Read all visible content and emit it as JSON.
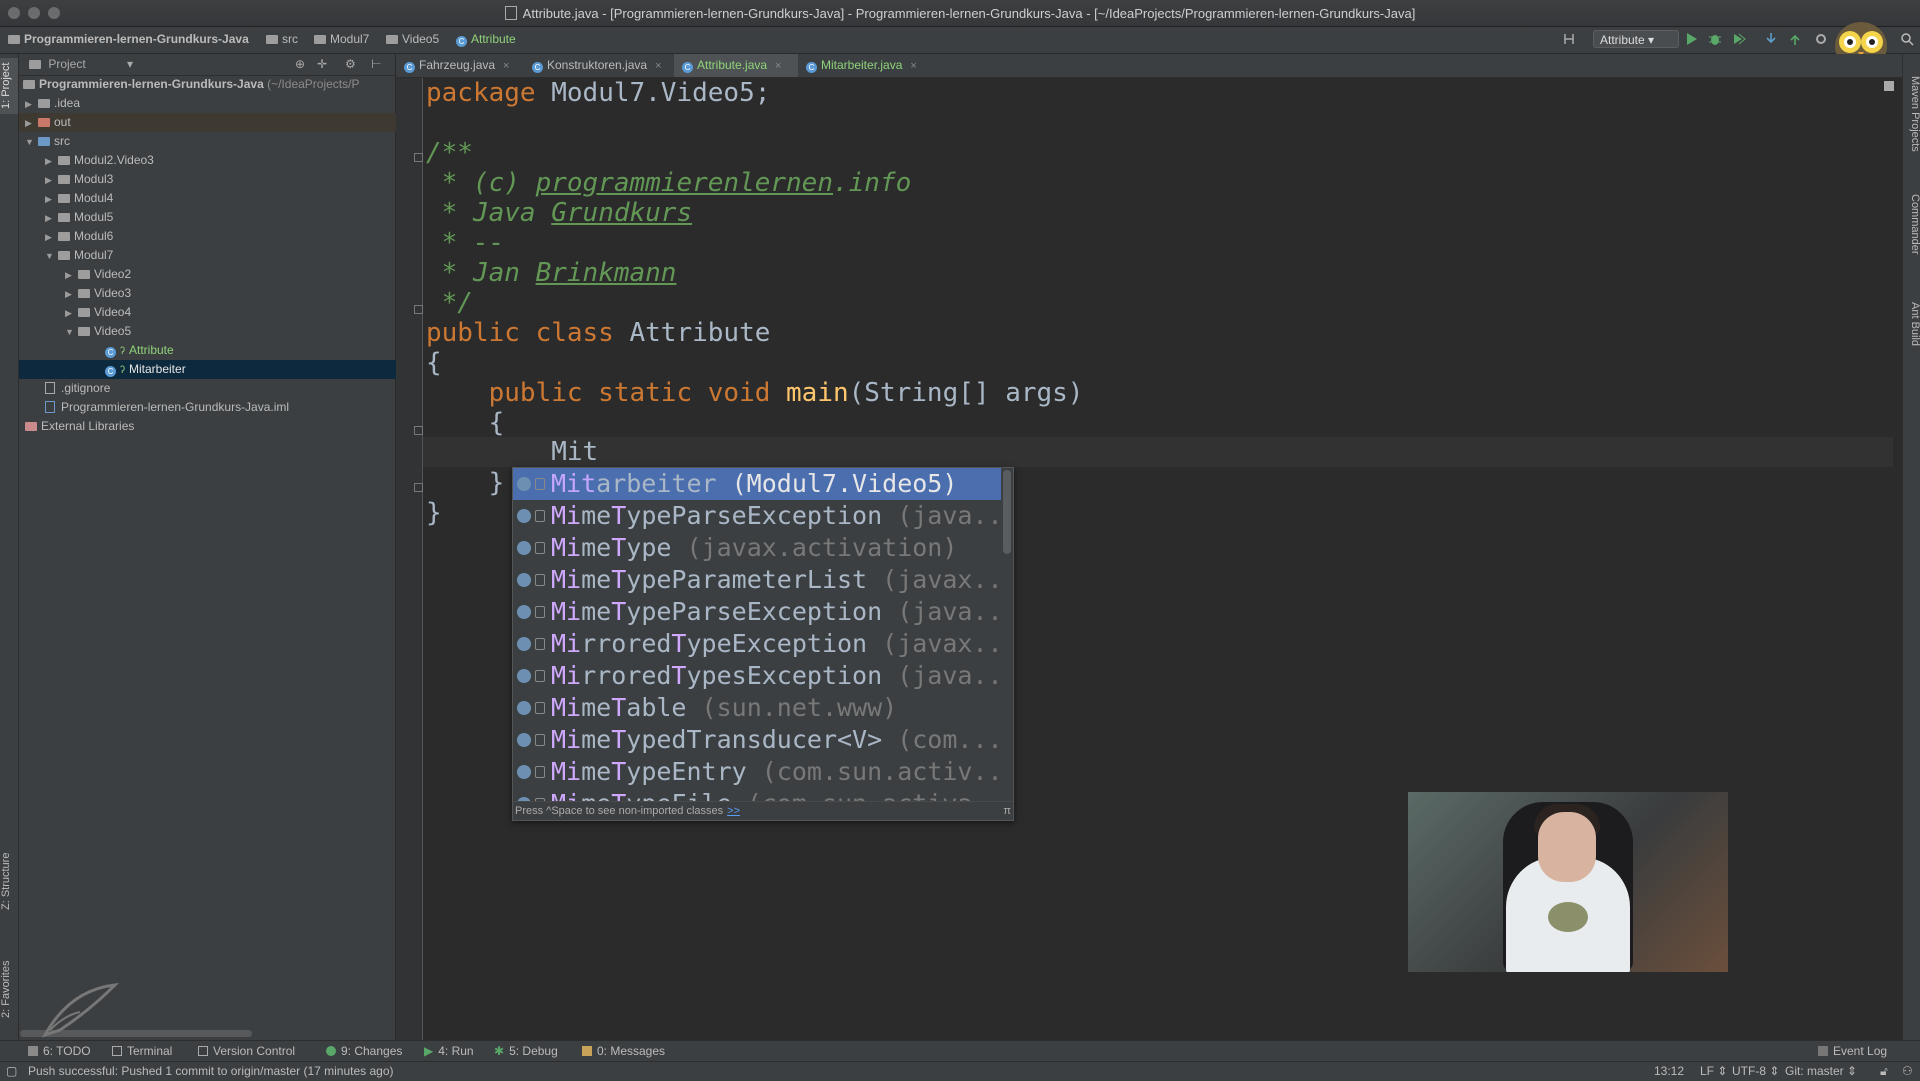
{
  "window": {
    "title": "Attribute.java - [Programmieren-lernen-Grundkurs-Java] - Programmieren-lernen-Grundkurs-Java - [~/IdeaProjects/Programmieren-lernen-Grundkurs-Java]"
  },
  "navbar": {
    "crumbs": [
      "Programmieren-lernen-Grundkurs-Java",
      "src",
      "Modul7",
      "Video5",
      "Attribute"
    ],
    "run_config": "Attribute"
  },
  "left_stripe": {
    "project": "1: Project",
    "structure": "Z: Structure",
    "favorites": "2: Favorites"
  },
  "right_stripe": {
    "maven": "Maven Projects",
    "commander": "Commander",
    "ant": "Ant Build"
  },
  "project_panel": {
    "header": "Project",
    "tree": [
      {
        "label": "Programmieren-lernen-Grundkurs-Java",
        "suffix": "(~/IdeaProjects/P",
        "indent": 0
      },
      {
        "label": ".idea",
        "indent": 1
      },
      {
        "label": "out",
        "indent": 1
      },
      {
        "label": "src",
        "indent": 1
      },
      {
        "label": "Modul2.Video3",
        "indent": 2
      },
      {
        "label": "Modul3",
        "indent": 2
      },
      {
        "label": "Modul4",
        "indent": 2
      },
      {
        "label": "Modul5",
        "indent": 2
      },
      {
        "label": "Modul6",
        "indent": 2
      },
      {
        "label": "Modul7",
        "indent": 2
      },
      {
        "label": "Video2",
        "indent": 3
      },
      {
        "label": "Video3",
        "indent": 3
      },
      {
        "label": "Video4",
        "indent": 3
      },
      {
        "label": "Video5",
        "indent": 3
      },
      {
        "label": "Attribute",
        "indent": 4
      },
      {
        "label": "Mitarbeiter",
        "indent": 4
      },
      {
        "label": ".gitignore",
        "indent": 1
      },
      {
        "label": "Programmieren-lernen-Grundkurs-Java.iml",
        "indent": 1
      },
      {
        "label": "External Libraries",
        "indent": 0
      }
    ]
  },
  "tabs": [
    {
      "label": "Fahrzeug.java"
    },
    {
      "label": "Konstruktoren.java"
    },
    {
      "label": "Attribute.java"
    },
    {
      "label": "Mitarbeiter.java"
    }
  ],
  "code": {
    "l1_kw": "package",
    "l1_rest": " Modul7.Video5;",
    "l3": "/**",
    "l4_pre": " * (c) ",
    "l4_link": "programmierenlernen",
    "l4_post": ".info",
    "l5_pre": " * Java ",
    "l5_link": "Grundkurs",
    "l6": " * --",
    "l7_pre": " * Jan ",
    "l7_link": "Brinkmann",
    "l8": " */",
    "l9_kw": "public class",
    "l9_rest": " Attribute",
    "l10": "{",
    "l11_kw": "    public static void ",
    "l11_fn": "main",
    "l11_rest": "(String[] args)",
    "l12": "    {",
    "l13": "        Mit",
    "l14": "    }",
    "l15": "}"
  },
  "completion": {
    "items": [
      {
        "match": "Mit",
        "rest": "arbeiter",
        "pkg": " (Modul7.Video5)"
      },
      {
        "match": "Mi",
        "m2": "me",
        "mid": "T",
        "rest": "ypeParseException",
        "pkg": " (java..."
      },
      {
        "match": "Mi",
        "m2": "me",
        "mid": "T",
        "rest": "ype",
        "pkg": " (javax.activation)"
      },
      {
        "match": "Mi",
        "m2": "me",
        "mid": "T",
        "rest": "ypeParameterList",
        "pkg": " (javax..."
      },
      {
        "match": "Mi",
        "m2": "me",
        "mid": "T",
        "rest": "ypeParseException",
        "pkg": " (java..."
      },
      {
        "match": "Mi",
        "m2": "rrored",
        "mid": "T",
        "rest": "ypeException",
        "pkg": " (javax..."
      },
      {
        "match": "Mi",
        "m2": "rrored",
        "mid": "T",
        "rest": "ypesException",
        "pkg": " (java..."
      },
      {
        "match": "Mi",
        "m2": "me",
        "mid": "T",
        "rest": "able",
        "pkg": " (sun.net.www)"
      },
      {
        "match": "Mi",
        "m2": "me",
        "mid": "T",
        "rest": "ypedTransducer<V>",
        "pkg": " (com...."
      },
      {
        "match": "Mi",
        "m2": "me",
        "mid": "T",
        "rest": "ypeEntry",
        "pkg": " (com.sun.activ..."
      },
      {
        "match": "Mi",
        "m2": "me",
        "mid": "T",
        "rest": "ypeFile",
        "pkg": " (com.sun.activa..."
      }
    ],
    "footer": "Press ^Space to see non-imported classes",
    "footer_link": ">>",
    "pi": "π"
  },
  "toolwindows": {
    "todo": "6: TODO",
    "terminal": "Terminal",
    "vcs": "Version Control",
    "changes": "9: Changes",
    "run": "4: Run",
    "debug": "5: Debug",
    "messages": "0: Messages",
    "event_log": "Event Log"
  },
  "status": {
    "message": "Push successful: Pushed 1 commit to origin/master (17 minutes ago)",
    "position": "13:12",
    "line_sep": "LF",
    "encoding": "UTF-8",
    "git": "Git: master"
  },
  "colors": {
    "accent": "#4b6eaf",
    "active_file": "#8fd37a",
    "keyword": "#cc7832",
    "comment": "#629755"
  }
}
